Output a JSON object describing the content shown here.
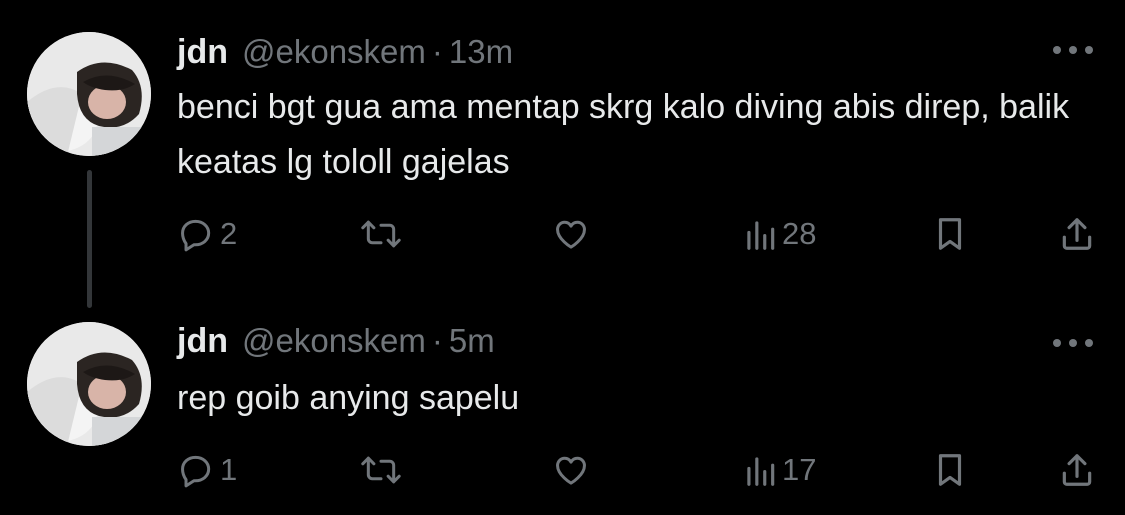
{
  "tweets": [
    {
      "display_name": "jdn",
      "handle": "@ekonskem",
      "separator": "·",
      "time": "13m",
      "text": "benci bgt gua ama mentap skrg kalo diving abis direp, balik keatas lg tololl gajelas",
      "replies": "2",
      "views": "28",
      "has_thread_line": true
    },
    {
      "display_name": "jdn",
      "handle": "@ekonskem",
      "separator": "·",
      "time": "5m",
      "text": "rep goib anying sapelu",
      "replies": "1",
      "views": "17",
      "has_thread_line": false
    }
  ],
  "icons": {
    "reply": "reply-icon",
    "retweet": "retweet-icon",
    "like": "heart-icon",
    "views": "views-icon",
    "bookmark": "bookmark-icon",
    "share": "share-icon",
    "more": "more-icon"
  },
  "colors": {
    "background": "#000000",
    "primary_text": "#e7e9ea",
    "secondary_text": "#71767b",
    "thread_line": "#333639"
  }
}
